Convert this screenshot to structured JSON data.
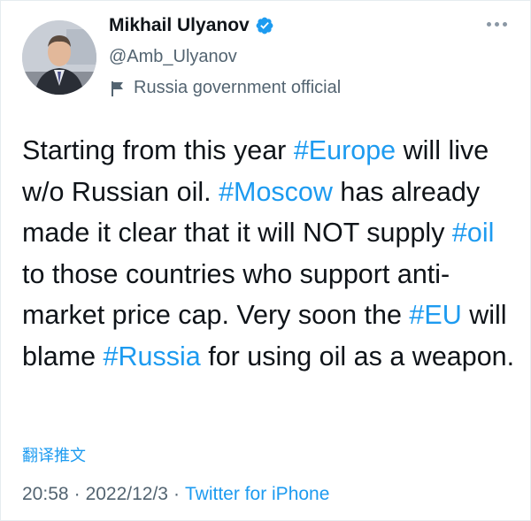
{
  "author": {
    "display_name": "Mikhail Ulyanov",
    "handle": "@Amb_Ulyanov",
    "label": "Russia government official",
    "verified": true
  },
  "tweet": {
    "segments": [
      {
        "text": "Starting from this year ",
        "hashtag": false
      },
      {
        "text": "#Europe",
        "hashtag": true
      },
      {
        "text": " will live w/o Russian oil. ",
        "hashtag": false
      },
      {
        "text": "#Moscow",
        "hashtag": true
      },
      {
        "text": " has already made it clear that it will NOT supply ",
        "hashtag": false
      },
      {
        "text": "#oil",
        "hashtag": true
      },
      {
        "text": " to those countries who support anti-market price cap. Very soon the ",
        "hashtag": false
      },
      {
        "text": "#EU",
        "hashtag": true
      },
      {
        "text": " will blame ",
        "hashtag": false
      },
      {
        "text": "#Russia",
        "hashtag": true
      },
      {
        "text": " for using oil as a weapon.",
        "hashtag": false
      }
    ],
    "translate_label": "翻译推文"
  },
  "meta": {
    "time": "20:58",
    "separator": "·",
    "date": "2022/12/3",
    "source": "Twitter for iPhone"
  },
  "colors": {
    "link": "#1d9bf0",
    "secondary_text": "#536471",
    "primary_text": "#0f1419"
  },
  "icons": {
    "verified": "verified-badge-icon",
    "label": "flag-icon",
    "more": "more-options-icon"
  }
}
